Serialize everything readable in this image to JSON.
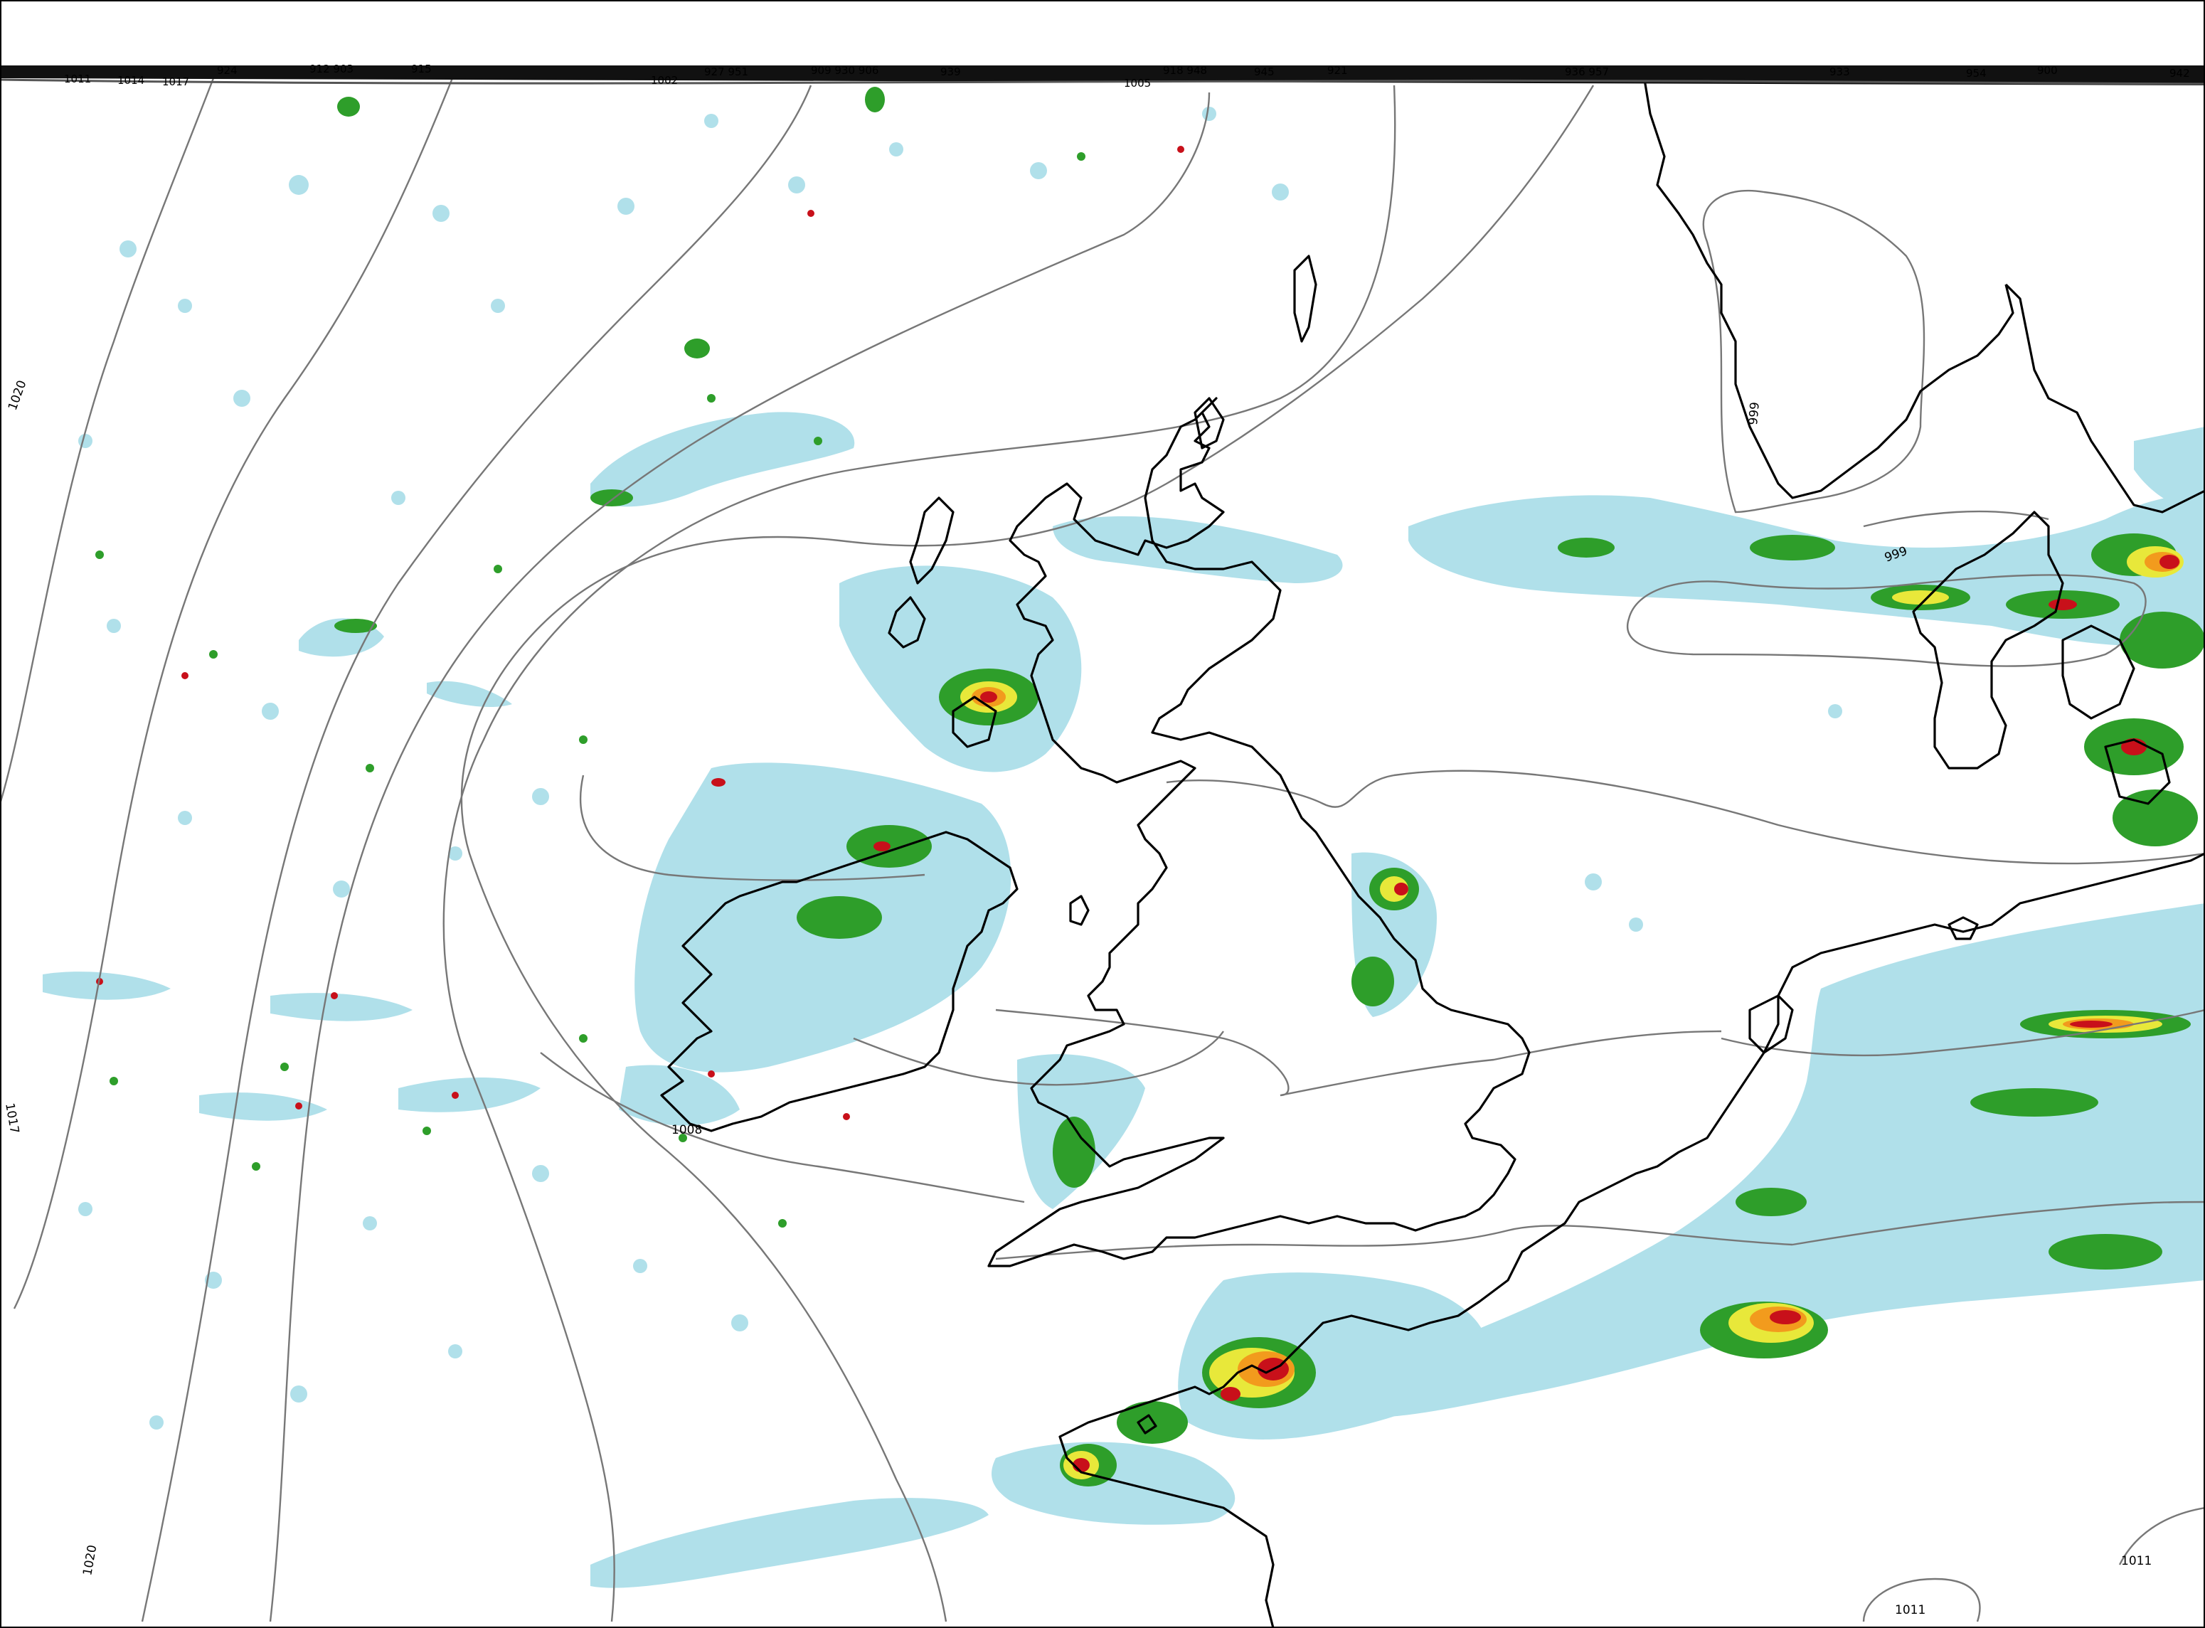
{
  "map": {
    "type": "weather-chart",
    "content": "precipitation shading with mean sea level pressure isobars over the British Isles, North Sea and northwest Europe"
  },
  "legend": {
    "precip_colors": {
      "light": "#b0e0ea",
      "moderate": "#2e9e2a",
      "heavy": "#e8e83a",
      "very_heavy": "#f29b1d",
      "extreme": "#c8101a"
    },
    "isobar_color": "#777777",
    "coast_color": "#000000"
  },
  "isobar_labels": [
    {
      "id": "lbl-1020-west",
      "text": "1020"
    },
    {
      "id": "lbl-1017-west",
      "text": "1017"
    },
    {
      "id": "lbl-1020-sw",
      "text": "1020"
    },
    {
      "id": "lbl-1008-ireland",
      "text": "1008"
    },
    {
      "id": "lbl-999-denmark",
      "text": "999"
    },
    {
      "id": "lbl-999-sweden",
      "text": "999"
    },
    {
      "id": "lbl-1011-se",
      "text": "1011"
    },
    {
      "id": "lbl-1011-s",
      "text": "1011"
    }
  ],
  "top_labels": [
    {
      "id": "top-1011",
      "text": "1011"
    },
    {
      "id": "top-1014",
      "text": "1014"
    },
    {
      "id": "top-1017",
      "text": "1017"
    },
    {
      "id": "top-924",
      "text": "924"
    },
    {
      "id": "top-912",
      "text": "912 903"
    },
    {
      "id": "top-915",
      "text": "915"
    },
    {
      "id": "top-1002",
      "text": "1002"
    },
    {
      "id": "top-927",
      "text": "927  951"
    },
    {
      "id": "top-909",
      "text": "909 930  906"
    },
    {
      "id": "top-939",
      "text": "939"
    },
    {
      "id": "top-1005",
      "text": "1005"
    },
    {
      "id": "top-918",
      "text": "918  948"
    },
    {
      "id": "top-945",
      "text": "945"
    },
    {
      "id": "top-921",
      "text": "921"
    },
    {
      "id": "top-936",
      "text": "936  957"
    },
    {
      "id": "top-933",
      "text": "933"
    },
    {
      "id": "top-954",
      "text": "954"
    },
    {
      "id": "top-900",
      "text": "900"
    },
    {
      "id": "top-942",
      "text": "942"
    }
  ]
}
